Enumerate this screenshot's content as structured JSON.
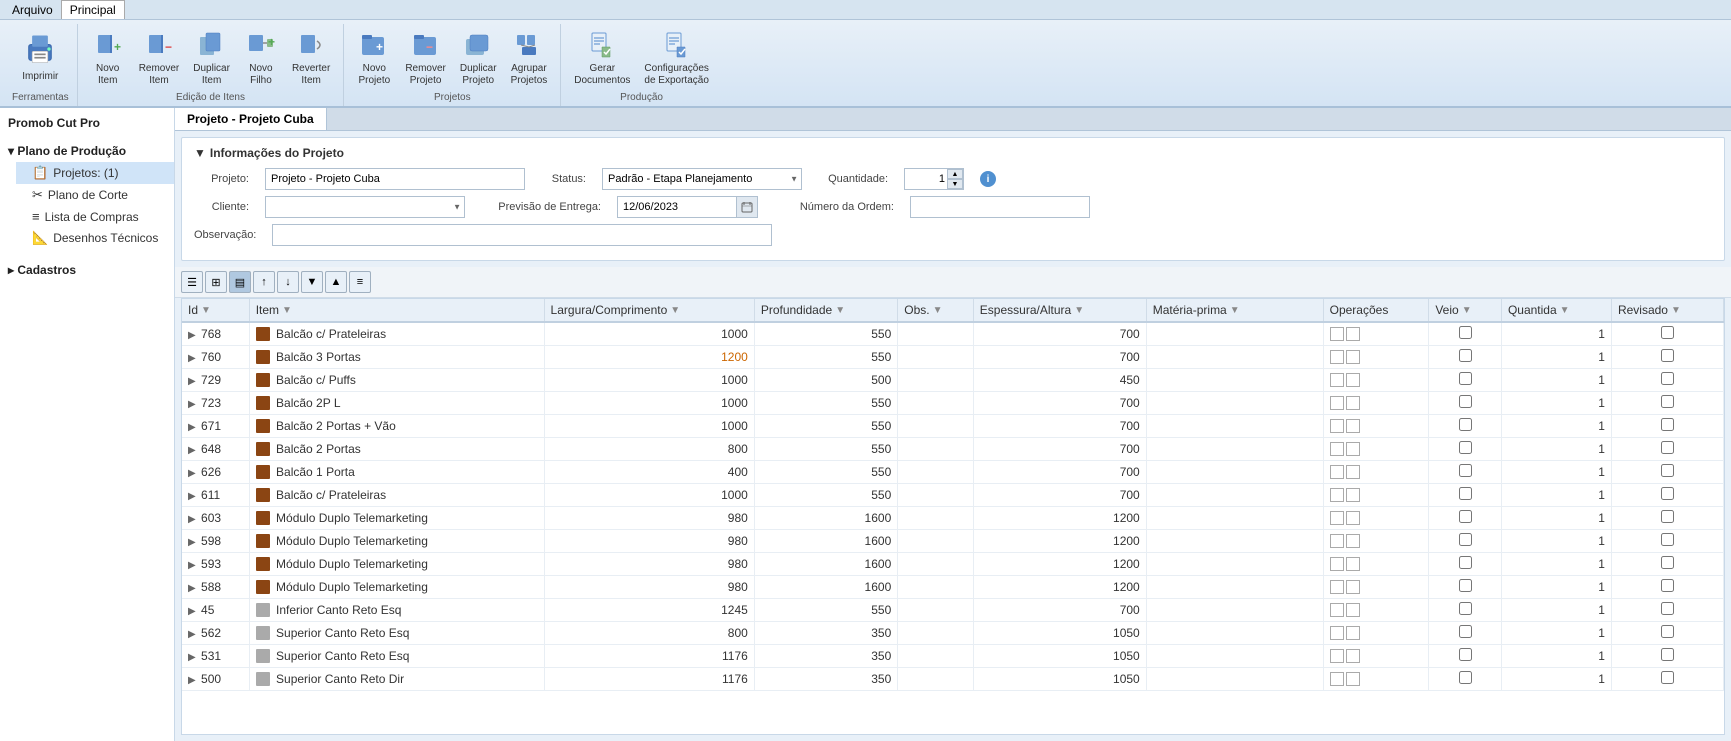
{
  "menu": {
    "items": [
      "Arquivo",
      "Principal"
    ]
  },
  "ribbon": {
    "groups": [
      {
        "label": "Ferramentas",
        "buttons": [
          {
            "id": "imprimir",
            "label": "Imprimir",
            "icon": "printer"
          }
        ]
      },
      {
        "label": "Edição de Itens",
        "buttons": [
          {
            "id": "novo-item",
            "label": "Novo\nItem",
            "icon": "new-item"
          },
          {
            "id": "remover-item",
            "label": "Remover\nItem",
            "icon": "remove-item"
          },
          {
            "id": "duplicar-item",
            "label": "Duplicar\nItem",
            "icon": "duplicate-item"
          },
          {
            "id": "novo-filho",
            "label": "Novo\nFilho",
            "icon": "new-child"
          },
          {
            "id": "reverter-item",
            "label": "Reverter\nItem",
            "icon": "revert-item"
          }
        ]
      },
      {
        "label": "Projetos",
        "buttons": [
          {
            "id": "novo-projeto",
            "label": "Novo\nProjeto",
            "icon": "new-project"
          },
          {
            "id": "remover-projeto",
            "label": "Remover\nProjeto",
            "icon": "remove-project"
          },
          {
            "id": "duplicar-projeto",
            "label": "Duplicar\nProjeto",
            "icon": "duplicate-project"
          },
          {
            "id": "agrupar-projetos",
            "label": "Agrupar\nProjetos",
            "icon": "group-projects"
          }
        ]
      },
      {
        "label": "Produção",
        "buttons": [
          {
            "id": "gerar-documentos",
            "label": "Gerar\nDocumentos",
            "icon": "generate-docs"
          },
          {
            "id": "config-exportacao",
            "label": "Configurações\nde Exportação",
            "icon": "config-export"
          }
        ]
      }
    ]
  },
  "app_title": "Promob Cut Pro",
  "sidebar": {
    "sections": [
      {
        "label": "Plano de Produção",
        "expanded": true,
        "items": [
          {
            "id": "projetos",
            "label": "Projetos: (1)",
            "icon": "folder",
            "selected": true
          },
          {
            "id": "plano-corte",
            "label": "Plano de Corte",
            "icon": "cut"
          },
          {
            "id": "lista-compras",
            "label": "Lista de Compras",
            "icon": "list"
          },
          {
            "id": "desenhos",
            "label": "Desenhos Técnicos",
            "icon": "drawing"
          }
        ]
      },
      {
        "label": "Cadastros",
        "expanded": false,
        "items": []
      }
    ]
  },
  "tab": "Projeto - Projeto Cuba",
  "project_info": {
    "section_label": "Informações do Projeto",
    "fields": {
      "projeto_label": "Projeto:",
      "projeto_value": "Projeto - Projeto Cuba",
      "cliente_label": "Cliente:",
      "cliente_value": "",
      "observacao_label": "Observação:",
      "observacao_value": "",
      "status_label": "Status:",
      "status_value": "Padrão - Etapa Planejamento",
      "previsao_label": "Previsão de Entrega:",
      "previsao_value": "12/06/2023",
      "quantidade_label": "Quantidade:",
      "quantidade_value": "1",
      "numero_ordem_label": "Número da Ordem:",
      "numero_ordem_value": ""
    }
  },
  "table": {
    "columns": [
      {
        "id": "id",
        "label": "Id",
        "filter": true
      },
      {
        "id": "item",
        "label": "Item",
        "filter": true
      },
      {
        "id": "largura",
        "label": "Largura/Comprimento",
        "filter": true
      },
      {
        "id": "profundidade",
        "label": "Profundidade",
        "filter": true
      },
      {
        "id": "obs",
        "label": "Obs.",
        "filter": true
      },
      {
        "id": "espessura",
        "label": "Espessura/Altura",
        "filter": true
      },
      {
        "id": "materia",
        "label": "Matéria-prima",
        "filter": true
      },
      {
        "id": "operacoes",
        "label": "Operações",
        "filter": false
      },
      {
        "id": "veio",
        "label": "Veio",
        "filter": true
      },
      {
        "id": "quantidade",
        "label": "Quantida",
        "filter": true
      },
      {
        "id": "revisado",
        "label": "Revisado",
        "filter": true
      }
    ],
    "rows": [
      {
        "id": "768",
        "item": "Balcão c/ Prateleiras",
        "icon": "brown",
        "largura": "1000",
        "profundidade": "550",
        "obs": "",
        "espessura": "700",
        "materia": "",
        "veio": false,
        "quantidade": "1",
        "revisado": false
      },
      {
        "id": "760",
        "item": "Balcão 3 Portas",
        "icon": "brown",
        "largura": "1200",
        "largura_orange": true,
        "profundidade": "550",
        "obs": "",
        "espessura": "700",
        "materia": "",
        "veio": false,
        "quantidade": "1",
        "revisado": false
      },
      {
        "id": "729",
        "item": "Balcão c/ Puffs",
        "icon": "brown",
        "largura": "1000",
        "profundidade": "500",
        "obs": "",
        "espessura": "450",
        "materia": "",
        "veio": false,
        "quantidade": "1",
        "revisado": false
      },
      {
        "id": "723",
        "item": "Balcão 2P L",
        "icon": "brown",
        "largura": "1000",
        "profundidade": "550",
        "obs": "",
        "espessura": "700",
        "materia": "",
        "veio": false,
        "quantidade": "1",
        "revisado": false
      },
      {
        "id": "671",
        "item": "Balcão 2 Portas + Vão",
        "icon": "brown",
        "largura": "1000",
        "profundidade": "550",
        "obs": "",
        "espessura": "700",
        "materia": "",
        "veio": false,
        "quantidade": "1",
        "revisado": false
      },
      {
        "id": "648",
        "item": "Balcão 2 Portas",
        "icon": "brown",
        "largura": "800",
        "profundidade": "550",
        "obs": "",
        "espessura": "700",
        "materia": "",
        "veio": false,
        "quantidade": "1",
        "revisado": false
      },
      {
        "id": "626",
        "item": "Balcão 1 Porta",
        "icon": "brown",
        "largura": "400",
        "profundidade": "550",
        "obs": "",
        "espessura": "700",
        "materia": "",
        "veio": false,
        "quantidade": "1",
        "revisado": false
      },
      {
        "id": "611",
        "item": "Balcão c/ Prateleiras",
        "icon": "brown",
        "largura": "1000",
        "profundidade": "550",
        "obs": "",
        "espessura": "700",
        "materia": "",
        "veio": false,
        "quantidade": "1",
        "revisado": false
      },
      {
        "id": "603",
        "item": "Módulo Duplo Telemarketing",
        "icon": "brown",
        "largura": "980",
        "profundidade": "1600",
        "obs": "",
        "espessura": "1200",
        "materia": "",
        "veio": false,
        "quantidade": "1",
        "revisado": false
      },
      {
        "id": "598",
        "item": "Módulo Duplo Telemarketing",
        "icon": "brown",
        "largura": "980",
        "profundidade": "1600",
        "obs": "",
        "espessura": "1200",
        "materia": "",
        "veio": false,
        "quantidade": "1",
        "revisado": false
      },
      {
        "id": "593",
        "item": "Módulo Duplo Telemarketing",
        "icon": "brown",
        "largura": "980",
        "profundidade": "1600",
        "obs": "",
        "espessura": "1200",
        "materia": "",
        "veio": false,
        "quantidade": "1",
        "revisado": false
      },
      {
        "id": "588",
        "item": "Módulo Duplo Telemarketing",
        "icon": "brown",
        "largura": "980",
        "profundidade": "1600",
        "obs": "",
        "espessura": "1200",
        "materia": "",
        "veio": false,
        "quantidade": "1",
        "revisado": false
      },
      {
        "id": "45",
        "item": "Inferior Canto Reto Esq",
        "icon": "gray",
        "largura": "1245",
        "profundidade": "550",
        "obs": "",
        "espessura": "700",
        "materia": "",
        "veio": false,
        "quantidade": "1",
        "revisado": false
      },
      {
        "id": "562",
        "item": "Superior Canto Reto Esq",
        "icon": "gray",
        "largura": "800",
        "profundidade": "350",
        "obs": "",
        "espessura": "1050",
        "materia": "",
        "veio": false,
        "quantidade": "1",
        "revisado": false
      },
      {
        "id": "531",
        "item": "Superior Canto Reto Esq",
        "icon": "gray",
        "largura": "1176",
        "profundidade": "350",
        "obs": "",
        "espessura": "1050",
        "materia": "",
        "veio": false,
        "quantidade": "1",
        "revisado": false
      },
      {
        "id": "500",
        "item": "Superior Canto Reto Dir",
        "icon": "gray",
        "largura": "1176",
        "profundidade": "350",
        "obs": "",
        "espessura": "1050",
        "materia": "",
        "veio": false,
        "quantidade": "1",
        "revisado": false
      }
    ]
  },
  "toolbar_buttons": [
    {
      "id": "tb1",
      "label": "☰"
    },
    {
      "id": "tb2",
      "label": "⊞"
    },
    {
      "id": "tb3",
      "label": "▤"
    },
    {
      "id": "tb4",
      "label": "↑"
    },
    {
      "id": "tb5",
      "label": "↓"
    },
    {
      "id": "tb6",
      "label": "▼"
    },
    {
      "id": "tb7",
      "label": "▲"
    },
    {
      "id": "tb8",
      "label": "≡"
    }
  ]
}
